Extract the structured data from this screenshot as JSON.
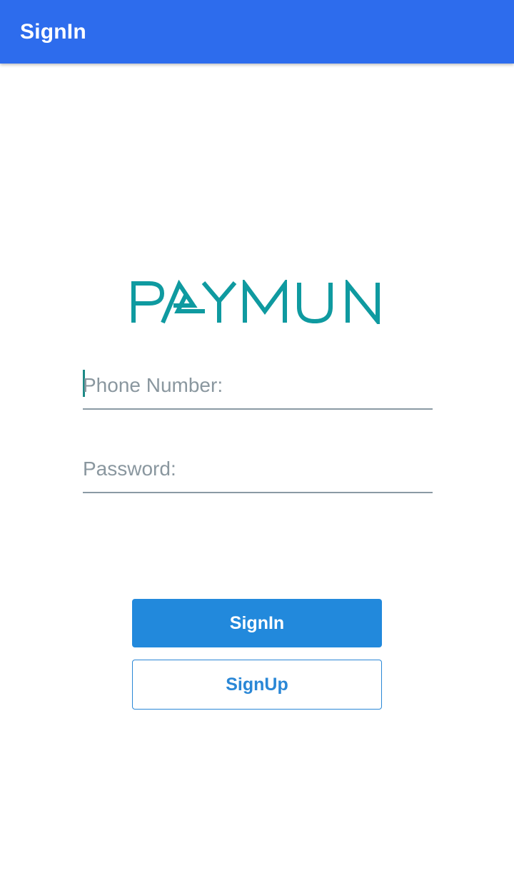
{
  "appbar": {
    "title": "SignIn"
  },
  "logo": {
    "text": "PAYMUN",
    "color": "#0f9aa0"
  },
  "form": {
    "phone": {
      "placeholder": "Phone Number:",
      "value": ""
    },
    "password": {
      "placeholder": "Password:",
      "value": ""
    }
  },
  "buttons": {
    "signin_label": "SignIn",
    "signup_label": "SignUp"
  },
  "colors": {
    "appbar": "#2d6ced",
    "primary_button": "#2289dc",
    "accent": "#0f9aa0"
  }
}
